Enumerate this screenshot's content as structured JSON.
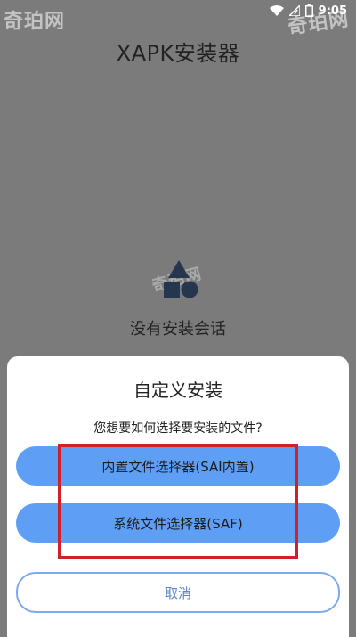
{
  "status_bar": {
    "time": "9:05"
  },
  "watermark": {
    "text": "奇珀网"
  },
  "app": {
    "title": "XAPK安装器",
    "empty_text": "没有安装会话"
  },
  "dialog": {
    "title": "自定义安装",
    "subtitle": "您想要如何选择要安装的文件?",
    "sai_button": "内置文件选择器(SAI内置)",
    "saf_button": "系统文件选择器(SAF)",
    "cancel_button": "取消"
  },
  "colors": {
    "background": "#7b7b7b",
    "primary_button": "#5f9ef5",
    "cancel_border": "#7da9ee",
    "highlight": "#d0202a"
  }
}
